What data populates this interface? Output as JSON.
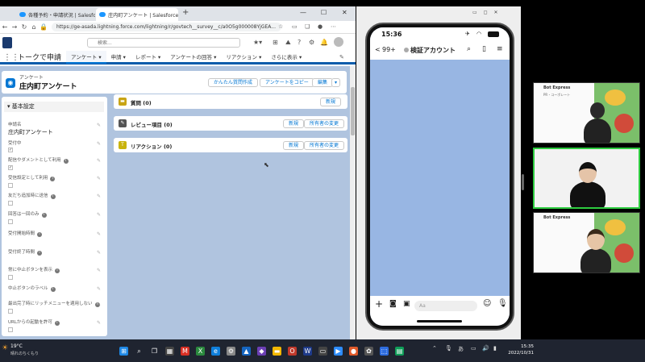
{
  "browser": {
    "tabs": [
      {
        "label": "各種予約・申請状況 | Salesforce"
      },
      {
        "label": "庄内町アンケート | Salesforce",
        "active": true
      }
    ],
    "url": "https://ge-asada.lightning.force.com/lightning/r/govtech__survey__c/a0O5g000008YjGEA...",
    "new_tab": "+",
    "window_controls": {
      "minimize": "—",
      "maximize": "☐",
      "close": "✕"
    }
  },
  "sf": {
    "search_placeholder": "検索...",
    "app_name": "トークで申請",
    "nav": [
      "アンケート",
      "申請",
      "レポート",
      "アンケートの回答",
      "リアクション",
      "さらに表示"
    ],
    "record": {
      "object_label": "アンケート",
      "title": "庄内町アンケート",
      "buttons": [
        "かんたん質問作成",
        "アンケートをコピー",
        "編集"
      ]
    },
    "details": {
      "section_title": "基本設定",
      "fields": [
        {
          "label": "申請名",
          "value": "庄内町アンケート"
        },
        {
          "label": "受付中",
          "checkbox": "✓"
        },
        {
          "label": "配信やダメントとして利用",
          "checkbox": "✓"
        },
        {
          "label": "受信設定として利用",
          "checkbox": ""
        },
        {
          "label": "友だち追加時に送信",
          "checkbox": ""
        },
        {
          "label": "回答は一回のみ",
          "checkbox": ""
        },
        {
          "label": "受付開始時間",
          "value": ""
        },
        {
          "label": "受付終了時間",
          "value": ""
        },
        {
          "label": "常に中止ボタンを表示",
          "checkbox": ""
        },
        {
          "label": "中止ボタンのラベル",
          "value": ""
        },
        {
          "label": "最出完了時にリッチメニューを適用しない",
          "checkbox": ""
        },
        {
          "label": "URLからの起動を許可",
          "checkbox": ""
        }
      ]
    },
    "related": [
      {
        "title": "質問 (0)",
        "buttons": [
          "新規"
        ],
        "color": "#c8a415",
        "icon": "folder-icon"
      },
      {
        "title": "レビュー項目 (0)",
        "buttons": [
          "新規",
          "所有者の変更"
        ],
        "color": "#555555",
        "icon": "wrench-icon"
      },
      {
        "title": "リアクション (0)",
        "buttons": [
          "新規",
          "所有者の変更"
        ],
        "color": "#c9b30d",
        "icon": "letter-icon"
      }
    ]
  },
  "phone": {
    "time": "15:36",
    "back_count": "99+",
    "chat_title": "検証アカウント",
    "input_placeholder": "Aa"
  },
  "participants": [
    {
      "company": "Bot Express",
      "name": "PR・コーポレート"
    },
    {
      "company": "",
      "name": ""
    },
    {
      "company": "Bot Express",
      "name": ""
    }
  ],
  "taskbar": {
    "weather_temp": "19°C",
    "weather_text": "晴れのちくもり",
    "time": "15:35",
    "date": "2022/10/31",
    "ime": "あ"
  },
  "colors": {
    "sf_blue": "#0176d3",
    "active_speaker": "#2ecc40"
  }
}
